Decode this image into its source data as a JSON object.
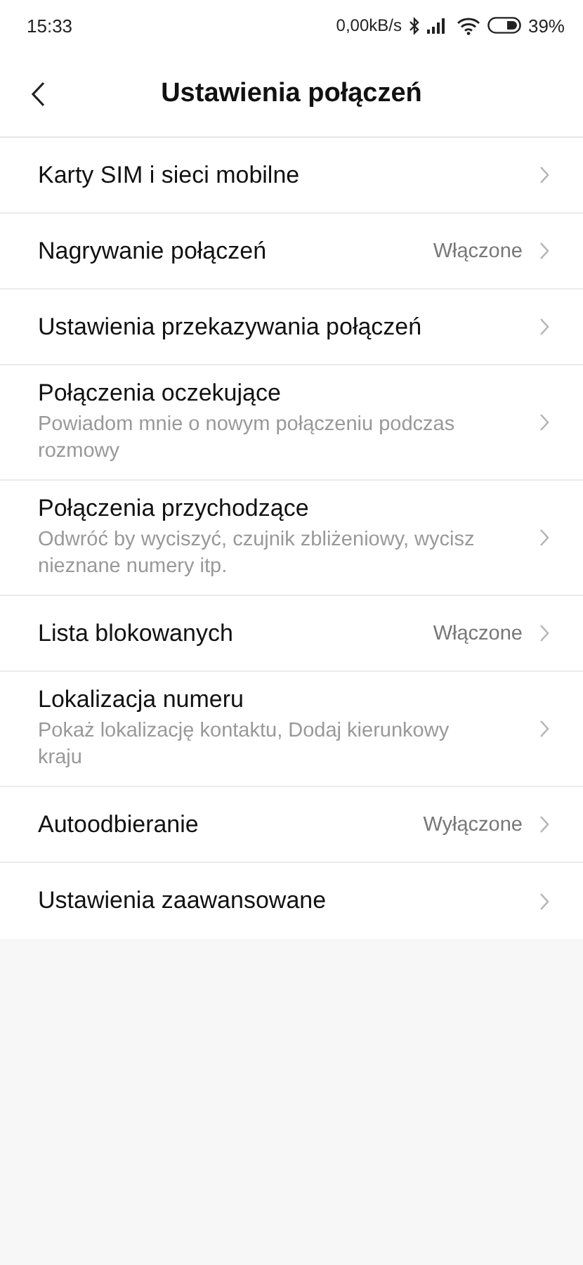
{
  "status_bar": {
    "time": "15:33",
    "speed": "0,00kB/s",
    "battery": "39%"
  },
  "header": {
    "title": "Ustawienia połączeń"
  },
  "items": [
    {
      "title": "Karty SIM i sieci mobilne"
    },
    {
      "title": "Nagrywanie połączeń",
      "value": "Włączone"
    },
    {
      "title": "Ustawienia przekazywania połączeń"
    },
    {
      "title": "Połączenia oczekujące",
      "subtitle": "Powiadom mnie o nowym połączeniu podczas rozmowy"
    },
    {
      "title": "Połączenia przychodzące",
      "subtitle": "Odwróć by wyciszyć, czujnik zbliżeniowy, wycisz nieznane numery itp."
    },
    {
      "title": "Lista blokowanych",
      "value": "Włączone"
    },
    {
      "title": "Lokalizacja numeru",
      "subtitle": "Pokaż lokalizację kontaktu, Dodaj kierunkowy kraju"
    },
    {
      "title": "Autoodbieranie",
      "value": "Wyłączone"
    },
    {
      "title": "Ustawienia zaawansowane"
    }
  ]
}
